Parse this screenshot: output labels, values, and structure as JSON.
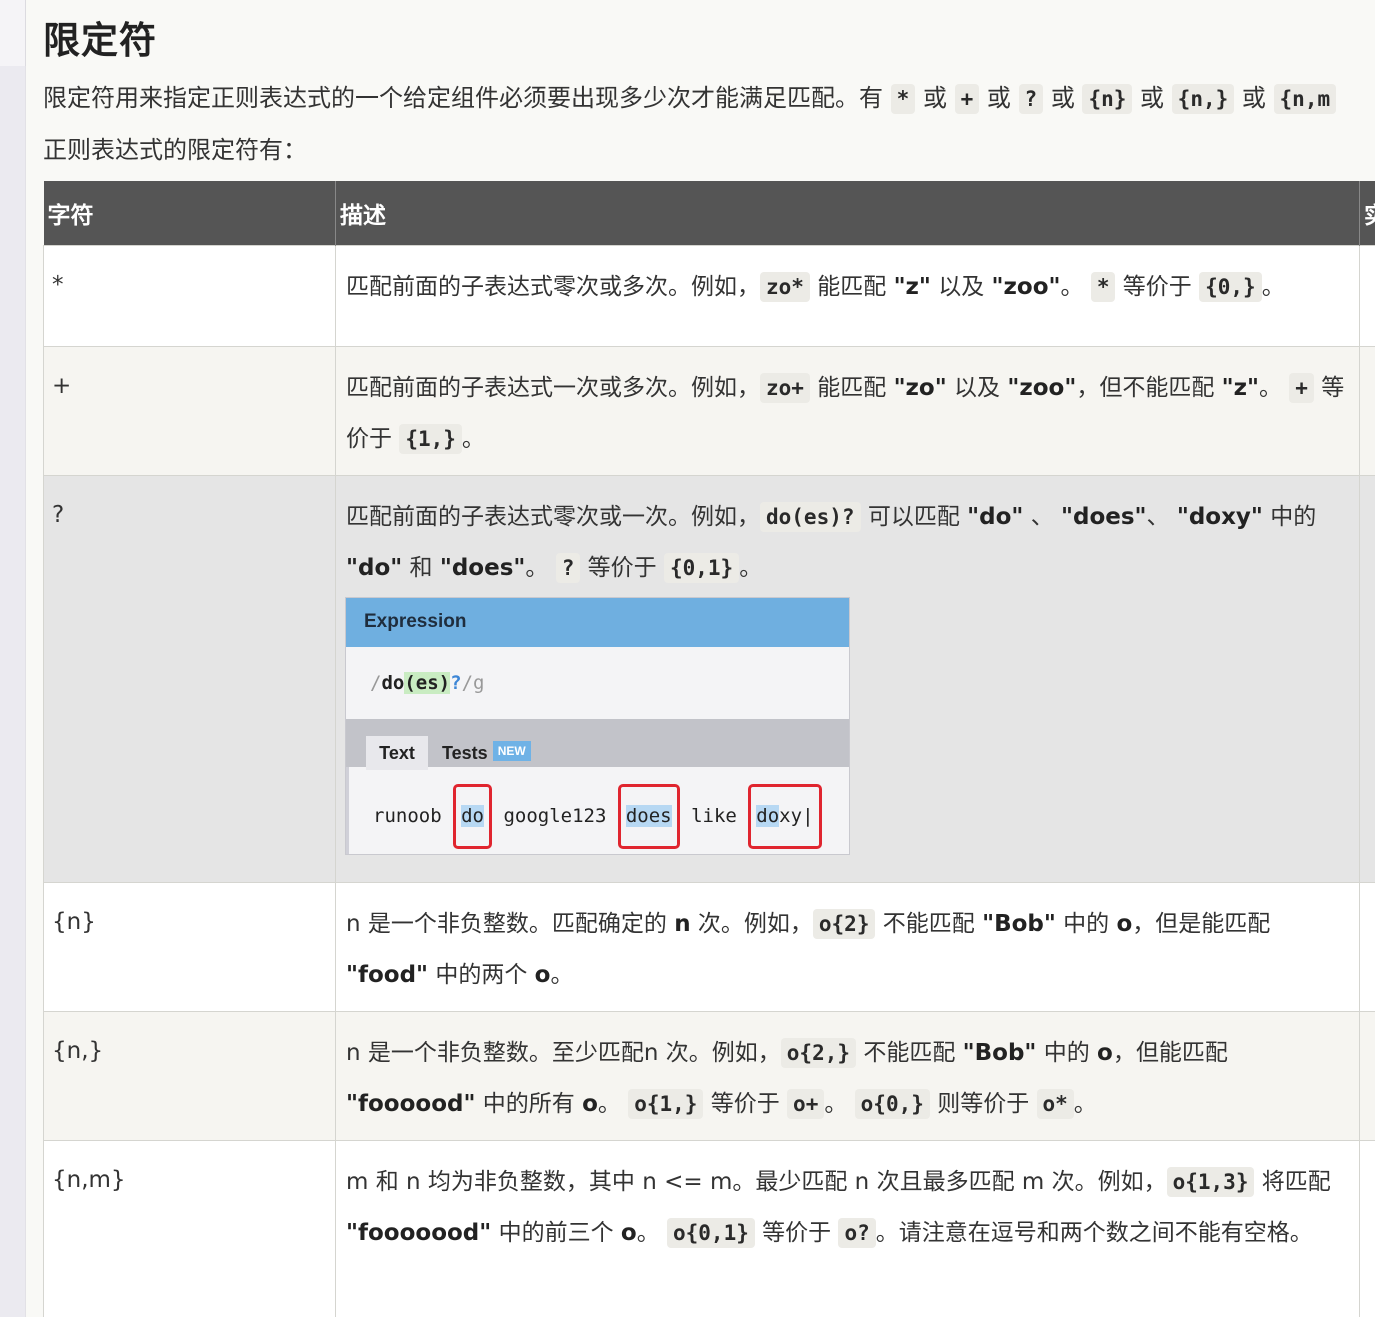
{
  "title": "限定符",
  "intro": {
    "text_a": "限定符用来指定正则表达式的一个给定组件必须要出现多少次才能满足匹配。有",
    "codes": [
      "*",
      "+",
      "?",
      "{n}",
      "{n,}",
      "{n,m"
    ],
    "or": "或",
    "line2": "正则表达式的限定符有："
  },
  "table": {
    "headers": [
      "字符",
      "描述",
      "实"
    ],
    "rows": [
      {
        "char": "*",
        "desc_parts": [
          "匹配前面的子表达式零次或多次。例如，",
          "zo*",
          "能匹配",
          "\"z\"",
          "以及",
          "\"zoo\"",
          "。",
          "*",
          "等价于",
          "{0,}",
          "。"
        ]
      },
      {
        "char": "+",
        "desc_parts": [
          "匹配前面的子表达式一次或多次。例如，",
          "zo+",
          "能匹配",
          "\"zo\"",
          "以及",
          "\"zoo\"",
          "，但不能匹配",
          "\"z\"",
          "。",
          "+",
          "等价于",
          "{1,}",
          "。"
        ]
      },
      {
        "char": "?",
        "desc_parts": [
          "匹配前面的子表达式零次或一次。例如，",
          "do(es)?",
          "可以匹配",
          "\"do\"",
          "、",
          "\"does\"",
          "、",
          "\"doxy\"",
          "中的",
          "\"do\"",
          "和",
          "\"does\"",
          "。",
          "?",
          "等价于",
          "{0,1}",
          "。"
        ]
      },
      {
        "char": "{n}",
        "desc_parts": [
          "n 是一个非负整数。匹配确定的",
          "n",
          "次。例如，",
          "o{2}",
          "不能匹配",
          "\"Bob\"",
          "中的",
          "o",
          "，但是能匹配",
          "\"food\"",
          "中的两个",
          "o",
          "。"
        ]
      },
      {
        "char": "{n,}",
        "desc_parts": [
          "n 是一个非负整数。至少匹配n 次。例如，",
          "o{2,}",
          "不能匹配",
          "\"Bob\"",
          "中的",
          "o",
          "，但能匹配",
          "\"foooood\"",
          "中的所有",
          "o",
          "。",
          "o{1,}",
          "等价于",
          "o+",
          "。",
          "o{0,}",
          "则等价于",
          "o*",
          "。"
        ]
      },
      {
        "char": "{n,m}",
        "desc_parts": [
          "m 和 n 均为非负整数，其中 n <= m。最少匹配 n 次且最多匹配 m 次。例如，",
          "o{1,3}",
          "将匹配",
          "\"fooooood\"",
          "中的前三个",
          "o",
          "。",
          "o{0,1}",
          "等价于",
          "o?",
          "。请注意在逗号和两个数之间不能有空格。"
        ]
      }
    ]
  },
  "regex_demo": {
    "header": "Expression",
    "expr": {
      "slash": "/",
      "lit": "do",
      "grp": "(es)",
      "qm": "?",
      "end": "/g"
    },
    "tabs": {
      "text": "Text",
      "tests": "Tests",
      "badge": "NEW"
    },
    "sample": {
      "w1": "runoob",
      "m1": "do",
      "w2": "google123",
      "m2": "does",
      "w3": "like",
      "m3": "do",
      "m3rest": "xy"
    }
  }
}
